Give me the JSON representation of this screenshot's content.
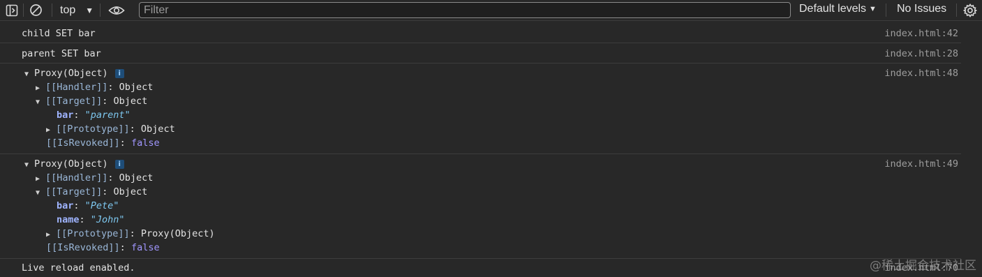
{
  "toolbar": {
    "context": "top",
    "filter_placeholder": "Filter",
    "levels": "Default levels",
    "issues": "No Issues"
  },
  "messages": [
    {
      "text": "child SET bar",
      "source": "index.html:42"
    },
    {
      "text": "parent SET bar",
      "source": "index.html:28"
    },
    {
      "source": "index.html:48",
      "header": "Proxy(Object)",
      "handler_key": "[[Handler]]",
      "handler_val": ": Object",
      "target_key": "[[Target]]",
      "target_val": ": Object",
      "props": [
        {
          "name": "bar",
          "value": "\"parent\""
        }
      ],
      "proto_key": "[[Prototype]]",
      "proto_val": ": Object",
      "revoked_key": "[[IsRevoked]]",
      "revoked_val": "false"
    },
    {
      "source": "index.html:49",
      "header": "Proxy(Object)",
      "handler_key": "[[Handler]]",
      "handler_val": ": Object",
      "target_key": "[[Target]]",
      "target_val": ": Object",
      "props": [
        {
          "name": "bar",
          "value": "\"Pete\""
        },
        {
          "name": "name",
          "value": "\"John\""
        }
      ],
      "proto_key": "[[Prototype]]",
      "proto_val": ": Proxy(Object)",
      "revoked_key": "[[IsRevoked]]",
      "revoked_val": "false"
    },
    {
      "text": "Live reload enabled.",
      "source": "index.html:70"
    }
  ],
  "watermark": "@稀土掘金技术社区",
  "icons": [
    "sidebar-toggle-icon",
    "clear-console-icon",
    "eye-icon",
    "gear-icon",
    "expand-triangle-icon",
    "info-icon"
  ]
}
